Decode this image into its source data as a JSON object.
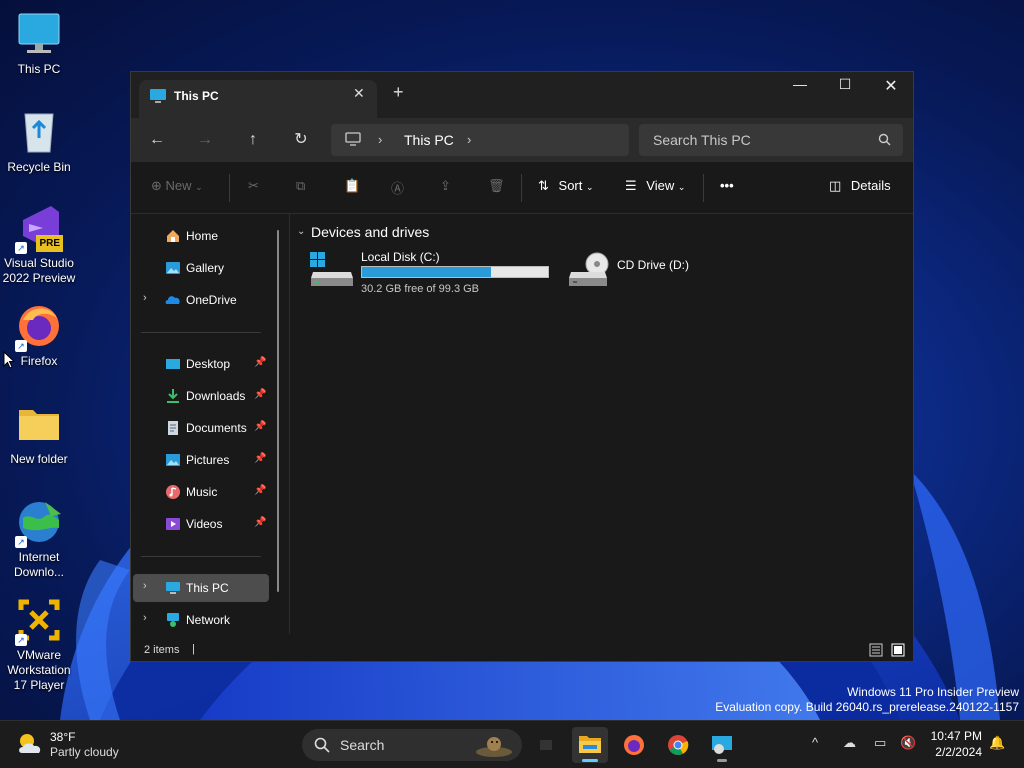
{
  "desktop": {
    "icons": [
      {
        "label": "This PC"
      },
      {
        "label": "Recycle Bin"
      },
      {
        "label": "Visual Studio 2022 Preview",
        "badge": "PRE"
      },
      {
        "label": "Firefox"
      },
      {
        "label": "New folder"
      },
      {
        "label": "Internet Downlo..."
      },
      {
        "label": "VMware Workstation 17 Player"
      }
    ]
  },
  "window": {
    "tab_title": "This PC",
    "new_tab": "+",
    "breadcrumb": [
      "This PC"
    ],
    "search_placeholder": "Search This PC",
    "commands": {
      "new": "New",
      "sort": "Sort",
      "view": "View",
      "more": "•••",
      "details": "Details"
    },
    "sidebar": {
      "top": [
        {
          "label": "Home",
          "icon": "home-icon"
        },
        {
          "label": "Gallery",
          "icon": "gallery-icon"
        },
        {
          "label": "OneDrive",
          "icon": "onedrive-icon"
        }
      ],
      "pinned": [
        {
          "label": "Desktop",
          "icon": "desktop-folder-icon"
        },
        {
          "label": "Downloads",
          "icon": "downloads-icon"
        },
        {
          "label": "Documents",
          "icon": "documents-icon"
        },
        {
          "label": "Pictures",
          "icon": "pictures-icon"
        },
        {
          "label": "Music",
          "icon": "music-icon"
        },
        {
          "label": "Videos",
          "icon": "videos-icon"
        }
      ],
      "bottom": [
        {
          "label": "This PC",
          "icon": "pc-icon",
          "selected": true
        },
        {
          "label": "Network",
          "icon": "network-icon"
        }
      ]
    },
    "group_header": "Devices and drives",
    "drives": [
      {
        "name": "Local Disk (C:)",
        "free_text": "30.2 GB free of 99.3 GB",
        "used_fraction": 0.696
      },
      {
        "name": "CD Drive (D:)"
      }
    ],
    "status": {
      "count": "2 items"
    }
  },
  "watermark": {
    "line1": "Windows 11 Pro Insider Preview",
    "line2": "Evaluation copy. Build 26040.rs_prerelease.240122-1157"
  },
  "taskbar": {
    "weather_temp": "38°F",
    "weather_cond": "Partly cloudy",
    "search_label": "Search",
    "time": "10:47 PM",
    "date": "2/2/2024"
  },
  "colors": {
    "accent": "#60cdff",
    "drive_fill": "#2b9ad9",
    "window_bg": "#191919"
  }
}
